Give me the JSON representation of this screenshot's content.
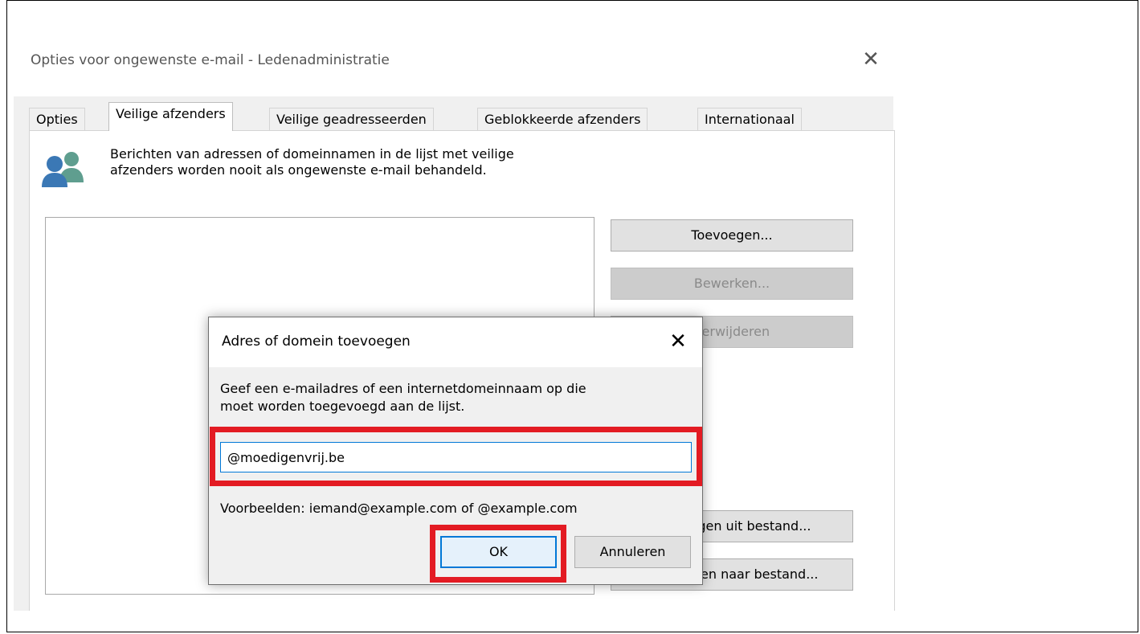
{
  "window": {
    "title": "Opties voor ongewenste e-mail - Ledenadministratie",
    "close_glyph": "✕"
  },
  "tabs": [
    {
      "label": "Opties",
      "active": false
    },
    {
      "label": "Veilige afzenders",
      "active": true
    },
    {
      "label": "Veilige geadresseerden",
      "active": false
    },
    {
      "label": "Geblokkeerde afzenders",
      "active": false
    },
    {
      "label": "Internationaal",
      "active": false
    }
  ],
  "info": {
    "icon": "people-icon",
    "line1": "Berichten van adressen of domeinnamen in de lijst met veilige",
    "line2": "afzenders worden nooit als ongewenste e-mail behandeld."
  },
  "side_buttons": {
    "add": "Toevoegen...",
    "edit": "Bewerken...",
    "remove": "Verwijderen",
    "import": "Toevoegen uit bestand...",
    "export": "Exporteren naar bestand..."
  },
  "dialog": {
    "title": "Adres of domein toevoegen",
    "close_glyph": "✕",
    "instructions_line1": "Geef een e-mailadres of een internetdomeinnaam op die",
    "instructions_line2": "moet worden toegevoegd aan de lijst.",
    "input_value": "@moedigenvrij.be",
    "examples": "Voorbeelden: iemand@example.com of @example.com",
    "ok_label": "OK",
    "cancel_label": "Annuleren"
  },
  "colors": {
    "highlight": "#e31b23",
    "focus_blue": "#0078d7",
    "icon_blue": "#3b78b5",
    "icon_teal": "#5f9e8f"
  }
}
